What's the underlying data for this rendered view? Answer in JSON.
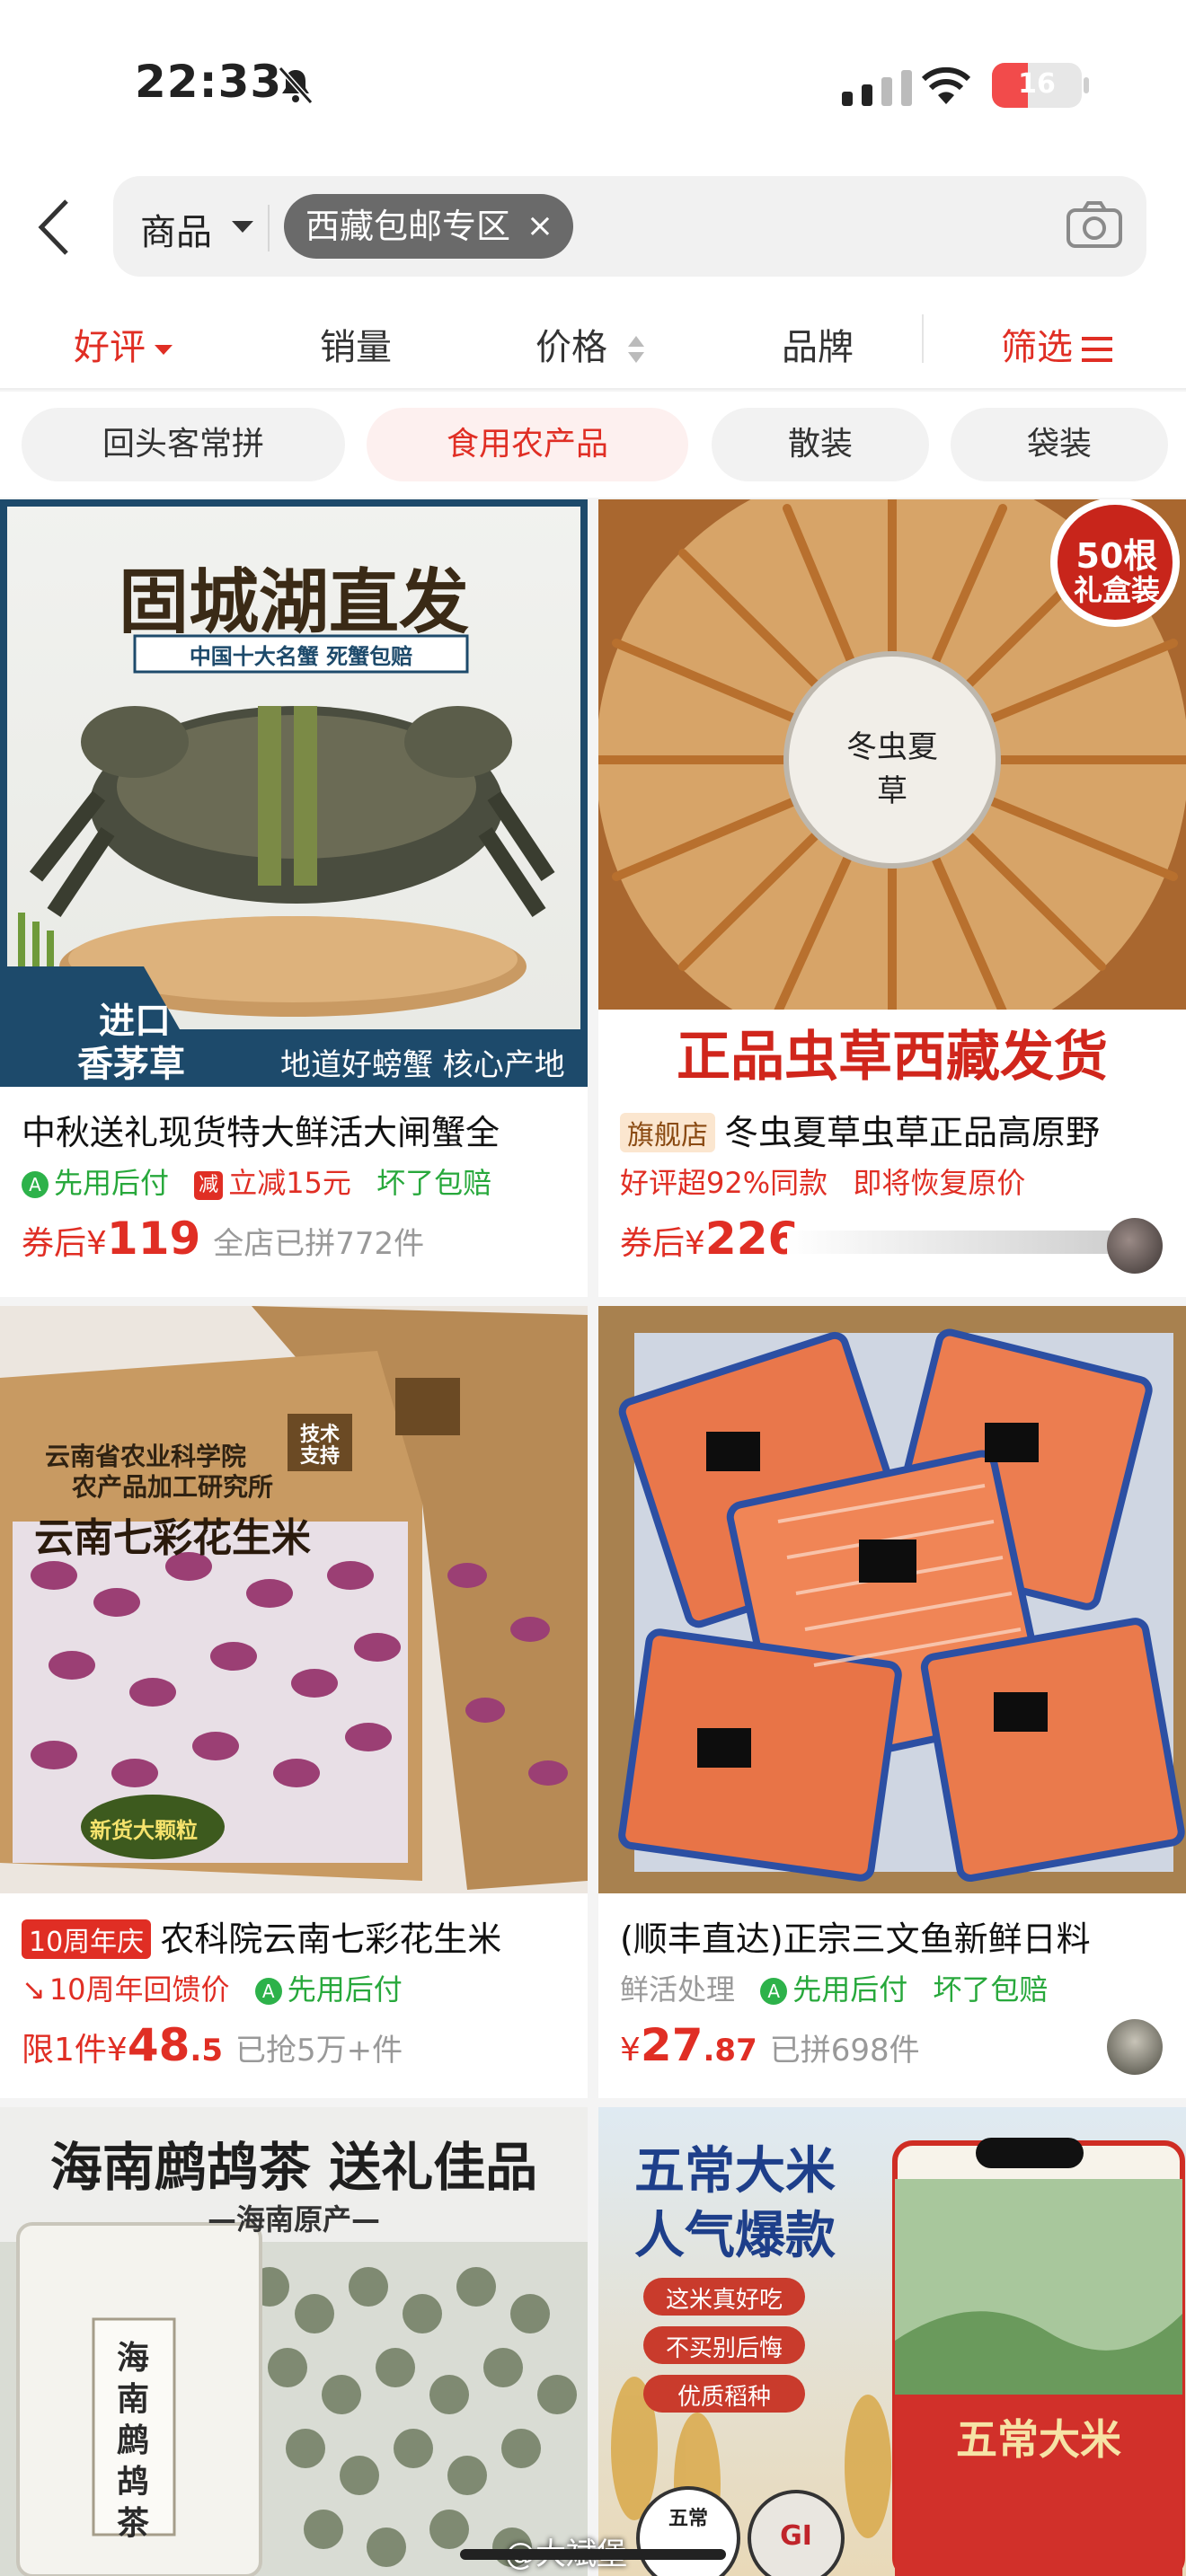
{
  "status": {
    "time": "22:33",
    "battery": "16",
    "battery_level": 0.16
  },
  "search": {
    "scope": "商品",
    "tag": "西藏包邮专区",
    "tag_close": "×"
  },
  "sorts": [
    {
      "label": "好评",
      "active": true
    },
    {
      "label": "销量",
      "active": false
    },
    {
      "label": "价格",
      "active": false
    },
    {
      "label": "品牌",
      "active": false
    },
    {
      "label": "筛选",
      "active": true
    }
  ],
  "chips": [
    {
      "label": "回头客常拼",
      "active": false
    },
    {
      "label": "食用农产品",
      "active": true
    },
    {
      "label": "散装",
      "active": false
    },
    {
      "label": "袋装",
      "active": false
    }
  ],
  "products": [
    {
      "img_text": {
        "headline": "固城湖直发",
        "sub": "中国十大名蟹 死蟹包赔",
        "corner1": "进口",
        "corner2": "香茅草",
        "footer": "地道好螃蟹 核心产地"
      },
      "title": "中秋送礼现货特大鲜活大闸蟹全",
      "tags": {
        "g_icon": "A",
        "green1": "先用后付",
        "r_icon": "减",
        "red1": "立减15元",
        "green2": "坏了包赔"
      },
      "price": {
        "label": "券后¥",
        "int": "119",
        "dec": "",
        "sold": "全店已拼772件"
      }
    },
    {
      "img_text": {
        "badge1": "50根",
        "badge2": "礼盒装",
        "lid": "冬虫夏草",
        "footer": "正品虫草西藏发货"
      },
      "title_tag": "旗舰店",
      "title": "冬虫夏草虫草正品高原野",
      "tags": {
        "red1": "好评超92%同款",
        "red2": "即将恢复原价"
      },
      "price": {
        "label": "券后¥",
        "int": "226",
        "dec": "",
        "sold": ""
      }
    },
    {
      "img_text": {
        "inst1": "云南省农业科学院",
        "inst2": "农产品加工研究所",
        "seal": "技术支持",
        "name": "云南七彩花生米",
        "bottom": "新货大颗粒"
      },
      "title_tag": "10周年庆",
      "title": "农科院云南七彩花生米",
      "tags": {
        "red1": "10周年回馈价",
        "g_icon": "A",
        "green1": "先用后付"
      },
      "price": {
        "label": "限1件¥",
        "int": "48",
        "dec": ".5",
        "sold": "已抢5万+件"
      }
    },
    {
      "img_text": {},
      "title": "(顺丰直达)正宗三文鱼新鲜日料",
      "tags": {
        "gray1": "鲜活处理",
        "g_icon": "A",
        "green1": "先用后付",
        "green2": "坏了包赔"
      },
      "price": {
        "label": "¥",
        "int": "27",
        "dec": ".87",
        "sold": "已拼698件"
      }
    },
    {
      "img_text": {
        "headline": "海南鹧鸪茶 送礼佳品",
        "sub": "—海南原产—",
        "bag": "海南鹧鸪茶"
      }
    },
    {
      "img_text": {
        "line1": "五常大米",
        "line2": "人气爆款",
        "p1": "这米真好吃",
        "p2": "不买别后悔",
        "p3": "优质稻种",
        "bag": "五常大米",
        "brand": "五常",
        "gi": "GI"
      }
    }
  ],
  "watermark": "@大斌堡",
  "colors": {
    "accent": "#e02e24",
    "green": "#27a83b",
    "gray": "#999999"
  }
}
